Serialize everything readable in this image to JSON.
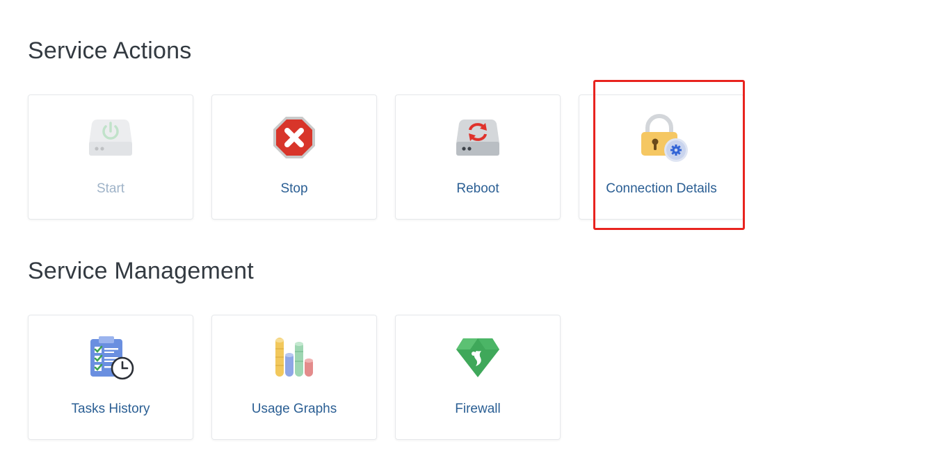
{
  "service_actions": {
    "title": "Service Actions",
    "tiles": [
      {
        "label": "Start",
        "icon": "power-start-icon",
        "disabled": true
      },
      {
        "label": "Stop",
        "icon": "stop-icon"
      },
      {
        "label": "Reboot",
        "icon": "reboot-icon"
      },
      {
        "label": "Connection Details",
        "icon": "lock-settings-icon",
        "highlighted": true
      }
    ]
  },
  "service_management": {
    "title": "Service Management",
    "tiles": [
      {
        "label": "Tasks History",
        "icon": "tasks-history-icon"
      },
      {
        "label": "Usage Graphs",
        "icon": "usage-graphs-icon"
      },
      {
        "label": "Firewall",
        "icon": "firewall-icon"
      }
    ]
  },
  "colors": {
    "label": "#2a5e93",
    "disabled_label": "#9fb3c8",
    "highlight": "#e8231e"
  }
}
